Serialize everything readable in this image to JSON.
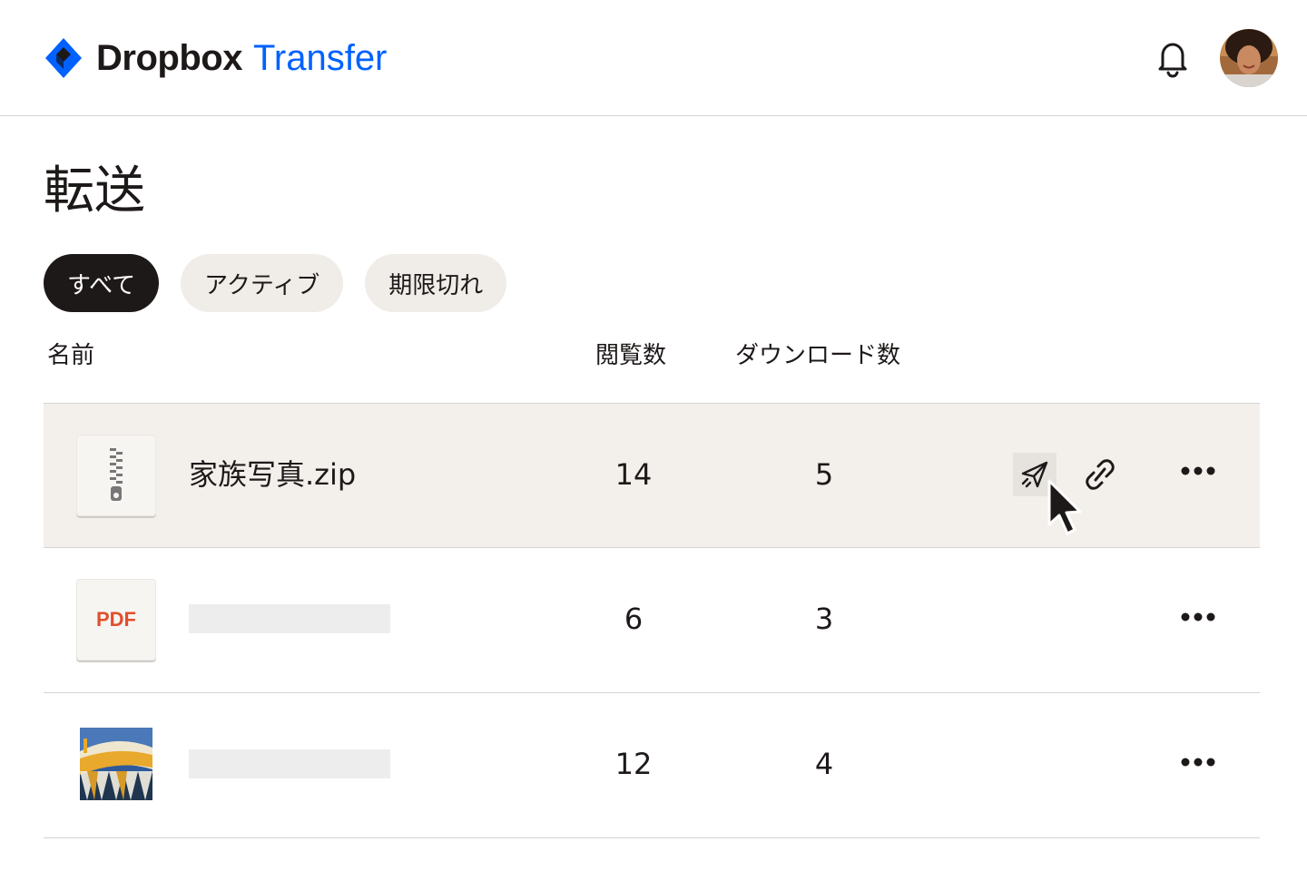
{
  "header": {
    "brand": "Dropbox",
    "product": "Transfer",
    "colors": {
      "brand_blue": "#0061fe",
      "text": "#1e1919"
    },
    "icons": [
      "dropbox-logo-icon",
      "bell-icon",
      "avatar"
    ]
  },
  "page": {
    "title": "転送"
  },
  "filters": [
    {
      "label": "すべて",
      "active": true
    },
    {
      "label": "アクティブ",
      "active": false
    },
    {
      "label": "期限切れ",
      "active": false
    }
  ],
  "table": {
    "columns": {
      "name": "名前",
      "views": "閲覧数",
      "downloads": "ダウンロード数"
    },
    "rows": [
      {
        "type": "zip",
        "icon": "zip-file-icon",
        "name": "家族写真.zip",
        "views": "14",
        "downloads": "5",
        "hovered": true
      },
      {
        "type": "pdf",
        "icon": "pdf-file-icon",
        "thumb_label": "PDF",
        "name": "",
        "views": "6",
        "downloads": "3"
      },
      {
        "type": "image",
        "icon": "image-thumbnail",
        "name": "",
        "views": "12",
        "downloads": "4"
      }
    ],
    "row_actions": [
      "send-icon",
      "link-icon",
      "more-icon"
    ]
  }
}
